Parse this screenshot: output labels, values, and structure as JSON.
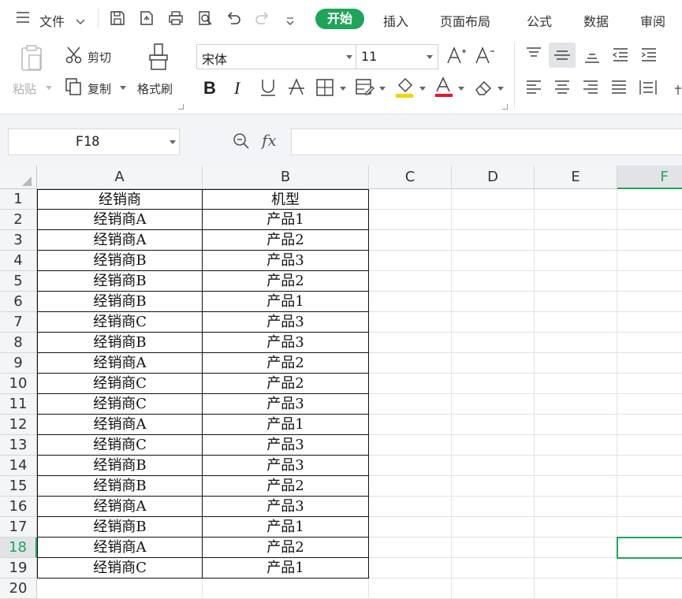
{
  "menu": {
    "file_label": "文件",
    "tabs": [
      "开始",
      "插入",
      "页面布局",
      "公式",
      "数据",
      "审阅"
    ]
  },
  "ribbon": {
    "paste_label": "粘贴",
    "cut_label": "剪切",
    "copy_label": "复制",
    "format_painter_label": "格式刷",
    "font_name": "宋体",
    "font_size": "11"
  },
  "formula_bar": {
    "name_box": "F18",
    "fx_label": "fx",
    "formula": ""
  },
  "sheet": {
    "columns": [
      "A",
      "B",
      "C",
      "D",
      "E",
      "F"
    ],
    "active_column": "F",
    "active_row": "18",
    "row_numbers": [
      "1",
      "2",
      "3",
      "4",
      "5",
      "6",
      "7",
      "8",
      "9",
      "10",
      "11",
      "12",
      "13",
      "14",
      "15",
      "16",
      "17",
      "18",
      "19",
      "20"
    ],
    "rows": [
      [
        "经销商",
        "机型"
      ],
      [
        "经销商A",
        "产品1"
      ],
      [
        "经销商A",
        "产品2"
      ],
      [
        "经销商B",
        "产品3"
      ],
      [
        "经销商B",
        "产品2"
      ],
      [
        "经销商B",
        "产品1"
      ],
      [
        "经销商C",
        "产品3"
      ],
      [
        "经销商B",
        "产品3"
      ],
      [
        "经销商A",
        "产品2"
      ],
      [
        "经销商C",
        "产品2"
      ],
      [
        "经销商C",
        "产品3"
      ],
      [
        "经销商A",
        "产品1"
      ],
      [
        "经销商C",
        "产品3"
      ],
      [
        "经销商B",
        "产品3"
      ],
      [
        "经销商B",
        "产品2"
      ],
      [
        "经销商A",
        "产品3"
      ],
      [
        "经销商B",
        "产品1"
      ],
      [
        "经销商A",
        "产品2"
      ],
      [
        "经销商C",
        "产品1"
      ]
    ]
  },
  "colors": {
    "accent": "#1fa55a"
  }
}
